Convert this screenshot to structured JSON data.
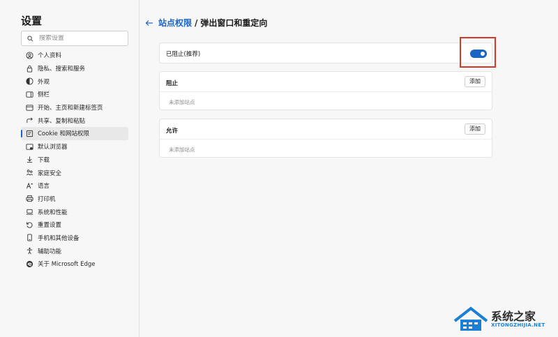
{
  "sidebar": {
    "title": "设置",
    "search_placeholder": "搜索设置",
    "items": [
      {
        "label": "个人资料",
        "icon": "profile-icon"
      },
      {
        "label": "隐私、搜索和服务",
        "icon": "lock-icon"
      },
      {
        "label": "外观",
        "icon": "appearance-icon"
      },
      {
        "label": "侧栏",
        "icon": "sidebar-icon"
      },
      {
        "label": "开始、主页和新建标签页",
        "icon": "home-icon"
      },
      {
        "label": "共享、复制和粘贴",
        "icon": "share-icon"
      },
      {
        "label": "Cookie 和网站权限",
        "icon": "cookie-icon",
        "active": true
      },
      {
        "label": "默认浏览器",
        "icon": "browser-icon"
      },
      {
        "label": "下载",
        "icon": "download-icon"
      },
      {
        "label": "家庭安全",
        "icon": "family-icon"
      },
      {
        "label": "语言",
        "icon": "language-icon"
      },
      {
        "label": "打印机",
        "icon": "printer-icon"
      },
      {
        "label": "系统和性能",
        "icon": "laptop-icon"
      },
      {
        "label": "重置设置",
        "icon": "reset-icon"
      },
      {
        "label": "手机和其他设备",
        "icon": "phone-icon"
      },
      {
        "label": "辅助功能",
        "icon": "accessibility-icon"
      },
      {
        "label": "关于 Microsoft Edge",
        "icon": "edge-icon"
      }
    ]
  },
  "header": {
    "breadcrumb_link": "站点权限",
    "separator": "/",
    "current": "弹出窗口和重定向"
  },
  "blocked_setting": {
    "label": "已阻止(推荐)",
    "toggle_on": true
  },
  "block_section": {
    "title": "阻止",
    "add_label": "添加",
    "empty_text": "未添加站点"
  },
  "allow_section": {
    "title": "允许",
    "add_label": "添加",
    "empty_text": "未添加站点"
  },
  "watermark": {
    "text": "系统之家",
    "url": "XITONGZHIJIA.NET"
  },
  "colors": {
    "accent": "#1b64c4",
    "highlight_border": "#d4372c"
  }
}
